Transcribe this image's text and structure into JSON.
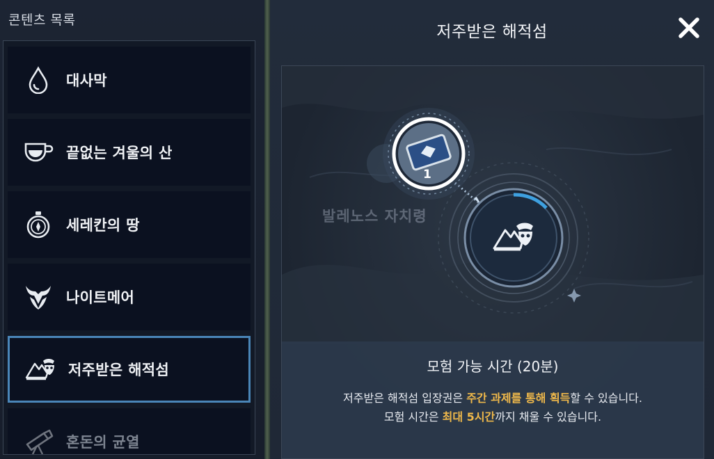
{
  "sidebar": {
    "title": "콘텐츠 목록",
    "items": [
      {
        "label": "대사막",
        "icon": "water-drop-icon"
      },
      {
        "label": "끝없는 겨울의 산",
        "icon": "cup-icon"
      },
      {
        "label": "세레칸의 땅",
        "icon": "compass-icon"
      },
      {
        "label": "나이트메어",
        "icon": "horned-mask-icon"
      },
      {
        "label": "저주받은 해적섬",
        "icon": "pirate-island-icon",
        "selected": true
      },
      {
        "label": "혼돈의 균열",
        "icon": "telescope-icon",
        "dim": true
      }
    ]
  },
  "detail": {
    "title": "저주받은 해적섬",
    "close_icon": "close-icon",
    "map": {
      "region_label": "발레노스 자치령",
      "ticket_count": "1",
      "ticket_icon": "ticket-icon",
      "destination_icon": "pirate-island-icon"
    },
    "info": {
      "title": "모험 가능 시간 (20분)",
      "line1_pre": "저주받은 해적섬 입장권은 ",
      "line1_highlight": "주간 과제를 통해 획득",
      "line1_post": "할 수 있습니다.",
      "line2_pre": "모험 시간은 ",
      "line2_highlight": "최대 5시간",
      "line2_post": "까지 채울 수 있습니다."
    }
  },
  "colors": {
    "accent_selected": "#4a86b8",
    "highlight_text": "#f0b94a"
  }
}
